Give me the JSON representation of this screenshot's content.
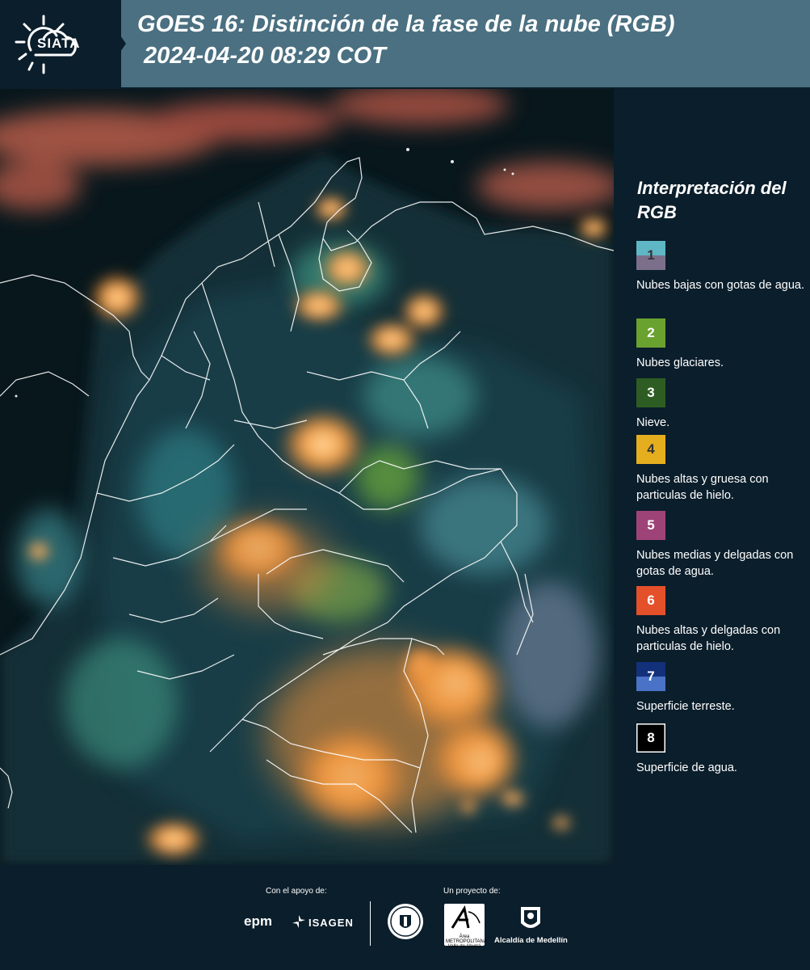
{
  "header": {
    "logo_text": "SIATA",
    "title": "GOES 16: Distinción de la fase de la nube (RGB)",
    "subtitle": "2024-04-20 08:29 COT"
  },
  "legend": {
    "title": "Interpretación del RGB",
    "items": [
      {
        "number": "1",
        "label": "Nubes bajas con gotas de agua.",
        "color_top": "#5fb6c4",
        "color_bottom": "#7b6f8c"
      },
      {
        "number": "2",
        "label": "Nubes glaciares.",
        "color": "#6aa230"
      },
      {
        "number": "3",
        "label": "Nieve.",
        "color": "#2d5d22"
      },
      {
        "number": "4",
        "label": "Nubes altas y gruesa con particulas de hielo.",
        "color": "#e4ae1e"
      },
      {
        "number": "5",
        "label": "Nubes medias y delgadas con gotas de agua.",
        "color": "#9e4378"
      },
      {
        "number": "6",
        "label": "Nubes altas y delgadas con particulas de hielo.",
        "color": "#e4502a"
      },
      {
        "number": "7",
        "label": "Superficie terreste.",
        "color_top": "#13307a",
        "color_bottom": "#4a72c6"
      },
      {
        "number": "8",
        "label": "Superficie de agua.",
        "color": "#000000"
      }
    ]
  },
  "footer": {
    "support_label": "Con el apoyo de:",
    "project_label": "Un proyecto de:",
    "sponsor_1": "epm",
    "sponsor_2": "ISAGEN",
    "partner_1": "Área METROPOLITANA Valle de Aburrá",
    "partner_2": "Alcaldía de Medellín"
  },
  "colors": {
    "background": "#0b1e2b",
    "header": "#4a7081"
  }
}
